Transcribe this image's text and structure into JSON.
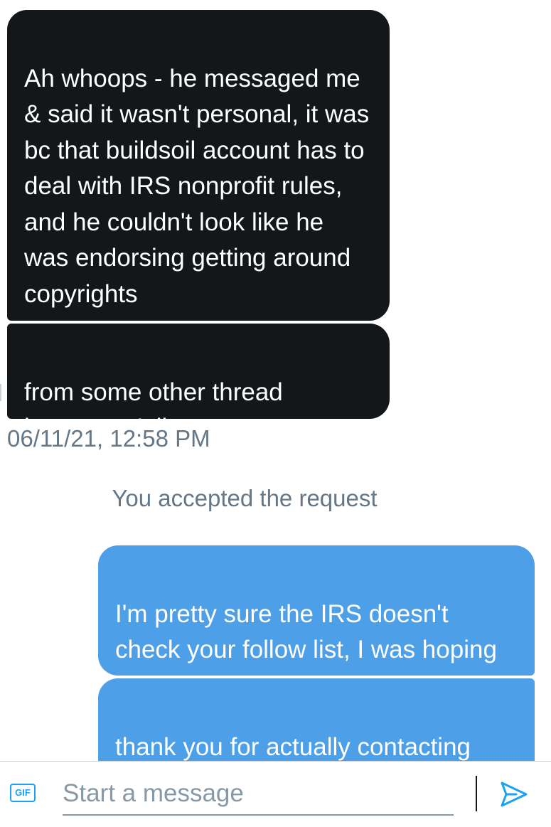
{
  "conversation": {
    "incoming": [
      {
        "text": "Ah whoops - he messaged me & said it wasn't personal, it was bc that buildsoil account has to deal with IRS nonprofit rules, and he couldn't look like he was endorsing getting around copyrights"
      },
      {
        "text": "from some other thread between y'all"
      }
    ],
    "timestamp": "06/11/21, 12:58 PM",
    "system_note": "You accepted the request",
    "outgoing": [
      {
        "text": "I'm pretty sure the IRS doesn't check your follow list, I was hoping maybe the heat was off"
      },
      {
        "text": "thank you for actually contacting them"
      }
    ]
  },
  "composer": {
    "gif_label": "GIF",
    "placeholder": "Start a message",
    "send_icon": "send-icon"
  },
  "colors": {
    "incoming_bubble": "#14171a",
    "outgoing_bubble": "#4d9fe8",
    "meta_text": "#657786",
    "accent": "#1da1f2"
  }
}
